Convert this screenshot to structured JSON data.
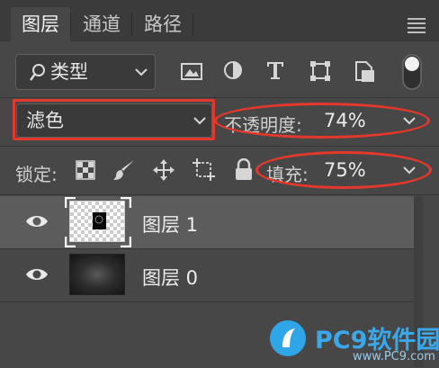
{
  "tabs": [
    {
      "label": "图层",
      "active": true
    },
    {
      "label": "通道",
      "active": false
    },
    {
      "label": "路径",
      "active": false
    }
  ],
  "filter": {
    "label": "类型",
    "search_icon": "search-icon"
  },
  "blend_mode": {
    "value": "滤色"
  },
  "opacity": {
    "label": "不透明度:",
    "value": "74%"
  },
  "lock": {
    "label": "锁定:"
  },
  "fill": {
    "label": "填充:",
    "value": "75%"
  },
  "layers": [
    {
      "name": "图层 1",
      "selected": true,
      "visible": true
    },
    {
      "name": "图层 0",
      "selected": false,
      "visible": true
    }
  ],
  "watermark": {
    "name": "PC9软件园",
    "url": "www.PC9.com"
  },
  "colors": {
    "panel": "#474747",
    "tab_bar": "#3b3b3b",
    "selected_row": "#5c5c5c",
    "annotation": "#e3382b",
    "watermark": "#2ea6e8"
  }
}
